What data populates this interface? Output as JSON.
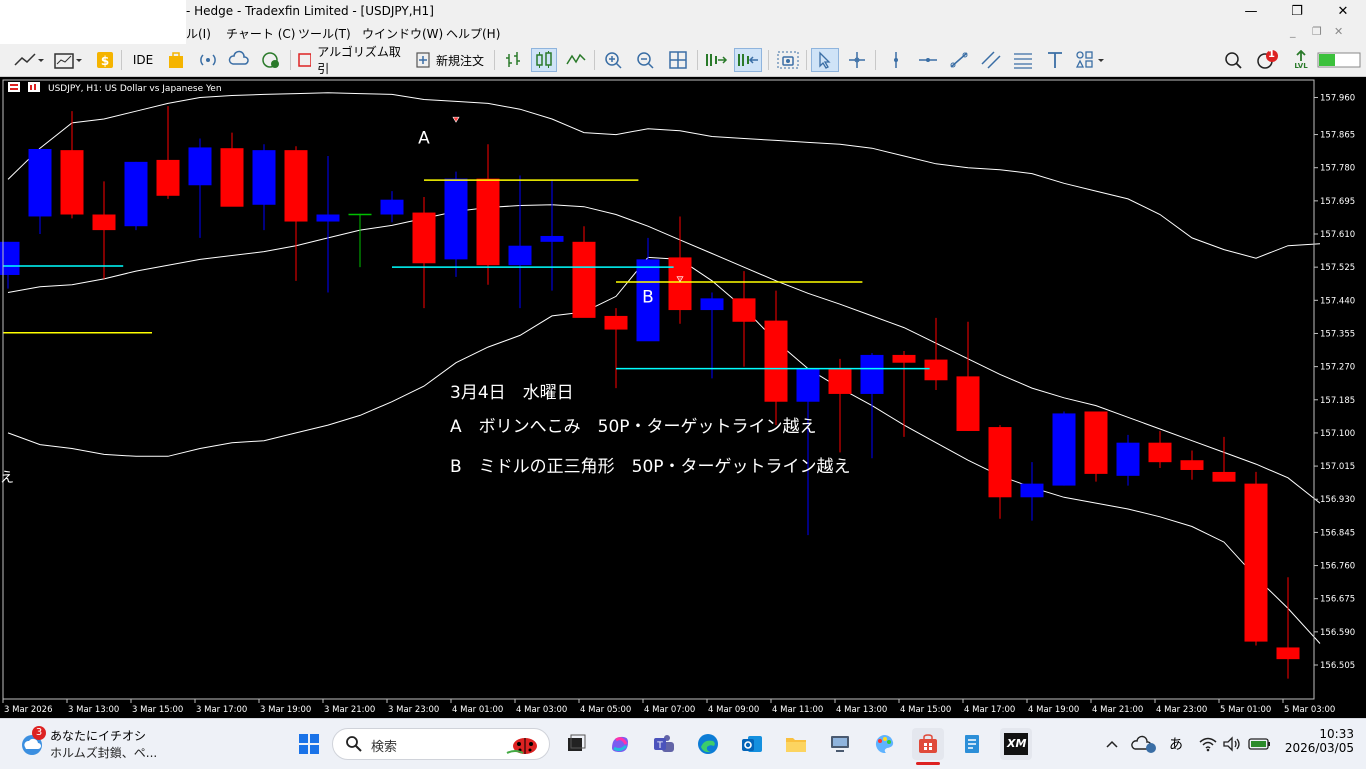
{
  "window": {
    "title": "- Hedge - Tradexfin Limited - [USDJPY,H1]",
    "controls": [
      "—",
      "❐",
      "✕"
    ],
    "mdi_controls": [
      "_",
      "❐",
      "✕"
    ]
  },
  "menu": {
    "items": [
      "ル(I)",
      "チャート (C)",
      "ツール(T)",
      "ウインドウ(W)",
      "ヘルプ(H)"
    ]
  },
  "toolbar": {
    "ide_label": "IDE",
    "algo_label": "アルゴリズム取引",
    "new_order_label": "新規注文",
    "notification_count": "1",
    "lvl_label": "LVL"
  },
  "chart": {
    "header": "USDJPY, H1:  US Dollar vs Japanese Yen",
    "annotations": {
      "label_a": "A",
      "label_b": "B",
      "date_line": "3月4日　水曜日",
      "line_a": "A　ボリンへこみ　50P・ターゲットライン越え",
      "line_b": "B　ミドルの正三角形　50P・ターゲットライン越え",
      "left_edge_char": "え"
    },
    "colors": {
      "background": "#000000",
      "bull": "#0000ff",
      "bear": "#ff0000",
      "bands": "#ffffff",
      "target_line": "#ffff00",
      "entry_line": "#00ffff"
    }
  },
  "chart_data": {
    "type": "candlestick",
    "symbol": "USDJPY",
    "timeframe": "H1",
    "y_ticks": [
      "157.960",
      "157.865",
      "157.780",
      "157.695",
      "157.610",
      "157.525",
      "157.440",
      "157.355",
      "157.270",
      "157.185",
      "157.100",
      "157.015",
      "156.930",
      "156.845",
      "156.760",
      "156.675",
      "156.590",
      "156.505"
    ],
    "x_labels": [
      "3 Mar 2026",
      "3 Mar 13:00",
      "3 Mar 15:00",
      "3 Mar 17:00",
      "3 Mar 19:00",
      "3 Mar 21:00",
      "3 Mar 23:00",
      "4 Mar 01:00",
      "4 Mar 03:00",
      "4 Mar 05:00",
      "4 Mar 07:00",
      "4 Mar 09:00",
      "4 Mar 11:00",
      "4 Mar 13:00",
      "4 Mar 15:00",
      "4 Mar 17:00",
      "4 Mar 19:00",
      "4 Mar 21:00",
      "4 Mar 23:00",
      "5 Mar 01:00",
      "5 Mar 03:00"
    ],
    "ylim": [
      156.46,
      157.99
    ],
    "candles": [
      {
        "o": 157.505,
        "h": 157.59,
        "l": 157.47,
        "c": 157.59
      },
      {
        "o": 157.655,
        "h": 157.828,
        "l": 157.61,
        "c": 157.828
      },
      {
        "o": 157.825,
        "h": 157.925,
        "l": 157.65,
        "c": 157.66
      },
      {
        "o": 157.66,
        "h": 157.745,
        "l": 157.495,
        "c": 157.62
      },
      {
        "o": 157.63,
        "h": 157.795,
        "l": 157.62,
        "c": 157.795
      },
      {
        "o": 157.8,
        "h": 157.938,
        "l": 157.7,
        "c": 157.708
      },
      {
        "o": 157.735,
        "h": 157.855,
        "l": 157.6,
        "c": 157.832
      },
      {
        "o": 157.83,
        "h": 157.87,
        "l": 157.7,
        "c": 157.68
      },
      {
        "o": 157.685,
        "h": 157.84,
        "l": 157.62,
        "c": 157.825
      },
      {
        "o": 157.825,
        "h": 157.835,
        "l": 157.49,
        "c": 157.642
      },
      {
        "o": 157.642,
        "h": 157.81,
        "l": 157.46,
        "c": 157.66
      },
      {
        "o": 157.66,
        "h": 157.662,
        "l": 157.525,
        "c": 157.66
      },
      {
        "o": 157.66,
        "h": 157.72,
        "l": 157.64,
        "c": 157.698
      },
      {
        "o": 157.665,
        "h": 157.705,
        "l": 157.42,
        "c": 157.535
      },
      {
        "o": 157.545,
        "h": 157.77,
        "l": 157.5,
        "c": 157.752
      },
      {
        "o": 157.752,
        "h": 157.84,
        "l": 157.48,
        "c": 157.53
      },
      {
        "o": 157.53,
        "h": 157.76,
        "l": 157.42,
        "c": 157.58
      },
      {
        "o": 157.59,
        "h": 157.75,
        "l": 157.465,
        "c": 157.605
      },
      {
        "o": 157.59,
        "h": 157.63,
        "l": 157.4,
        "c": 157.395
      },
      {
        "o": 157.4,
        "h": 157.42,
        "l": 157.215,
        "c": 157.365
      },
      {
        "o": 157.335,
        "h": 157.6,
        "l": 157.34,
        "c": 157.545
      },
      {
        "o": 157.55,
        "h": 157.655,
        "l": 157.38,
        "c": 157.415
      },
      {
        "o": 157.415,
        "h": 157.46,
        "l": 157.24,
        "c": 157.445
      },
      {
        "o": 157.445,
        "h": 157.515,
        "l": 157.27,
        "c": 157.385
      },
      {
        "o": 157.388,
        "h": 157.465,
        "l": 157.12,
        "c": 157.18
      },
      {
        "o": 157.18,
        "h": 157.245,
        "l": 156.838,
        "c": 157.265
      },
      {
        "o": 157.265,
        "h": 157.29,
        "l": 157.05,
        "c": 157.2
      },
      {
        "o": 157.2,
        "h": 157.305,
        "l": 157.035,
        "c": 157.3
      },
      {
        "o": 157.3,
        "h": 157.31,
        "l": 157.09,
        "c": 157.28
      },
      {
        "o": 157.288,
        "h": 157.395,
        "l": 157.21,
        "c": 157.235
      },
      {
        "o": 157.245,
        "h": 157.385,
        "l": 157.105,
        "c": 157.105
      },
      {
        "o": 157.115,
        "h": 157.12,
        "l": 156.88,
        "c": 156.935
      },
      {
        "o": 156.935,
        "h": 157.025,
        "l": 156.875,
        "c": 156.97
      },
      {
        "o": 156.965,
        "h": 157.155,
        "l": 156.965,
        "c": 157.15
      },
      {
        "o": 157.155,
        "h": 157.155,
        "l": 156.975,
        "c": 156.995
      },
      {
        "o": 156.99,
        "h": 157.095,
        "l": 156.965,
        "c": 157.075
      },
      {
        "o": 157.075,
        "h": 157.105,
        "l": 157.01,
        "c": 157.025
      },
      {
        "o": 157.03,
        "h": 157.055,
        "l": 156.98,
        "c": 157.005
      },
      {
        "o": 157.0,
        "h": 157.09,
        "l": 156.975,
        "c": 156.975
      },
      {
        "o": 156.97,
        "h": 157.0,
        "l": 156.555,
        "c": 156.565
      },
      {
        "o": 156.55,
        "h": 156.73,
        "l": 156.47,
        "c": 156.52
      }
    ],
    "bollinger": {
      "upper": [
        157.75,
        157.83,
        157.895,
        157.905,
        157.925,
        157.945,
        157.96,
        157.965,
        157.968,
        157.97,
        157.972,
        157.97,
        157.968,
        157.955,
        157.95,
        157.945,
        157.93,
        157.905,
        157.87,
        157.865,
        157.88,
        157.875,
        157.86,
        157.855,
        157.85,
        157.845,
        157.84,
        157.83,
        157.81,
        157.79,
        157.78,
        157.775,
        157.765,
        157.74,
        157.72,
        157.7,
        157.66,
        157.6,
        157.57,
        157.548,
        157.58,
        157.585
      ],
      "middle": [
        157.46,
        157.475,
        157.48,
        157.495,
        157.515,
        157.53,
        157.545,
        157.555,
        157.565,
        157.58,
        157.6,
        157.62,
        157.632,
        157.65,
        157.668,
        157.678,
        157.683,
        157.685,
        157.68,
        157.66,
        157.63,
        157.595,
        157.56,
        157.525,
        157.49,
        157.458,
        157.43,
        157.4,
        157.37,
        157.33,
        157.29,
        157.25,
        157.215,
        157.19,
        157.17,
        157.14,
        157.11,
        157.08,
        157.05,
        157.02,
        156.985,
        156.92
      ],
      "lower": [
        157.1,
        157.07,
        157.06,
        157.045,
        157.04,
        157.04,
        157.06,
        157.075,
        157.08,
        157.1,
        157.12,
        157.145,
        157.18,
        157.22,
        157.28,
        157.32,
        157.35,
        157.4,
        157.41,
        157.45,
        157.55,
        157.545,
        157.49,
        157.42,
        157.335,
        157.265,
        157.215,
        157.17,
        157.12,
        157.075,
        157.03,
        156.99,
        156.96,
        156.935,
        156.92,
        156.905,
        156.885,
        156.86,
        156.82,
        156.73,
        156.65,
        156.56
      ]
    },
    "horizontal_lines": [
      {
        "kind": "target",
        "y": 157.748,
        "from": 13,
        "to": 19.7
      },
      {
        "kind": "target",
        "y": 157.487,
        "from": 19,
        "to": 26.7
      },
      {
        "kind": "target",
        "y": 157.357,
        "from": -0.5,
        "to": 4.5
      },
      {
        "kind": "entry",
        "y": 157.528,
        "from": -0.5,
        "to": 3.6
      },
      {
        "kind": "entry",
        "y": 157.525,
        "from": 12,
        "to": 20.8
      },
      {
        "kind": "entry",
        "y": 157.265,
        "from": 19,
        "to": 28.8
      }
    ],
    "markers": [
      {
        "candle": 13,
        "price": 157.857,
        "text": "A"
      },
      {
        "candle": 20,
        "price": 157.45,
        "text": "B"
      }
    ]
  },
  "taskbar": {
    "weather_badge": "3",
    "news_line1": "あなたにイチオシ",
    "news_line2": "ホルムズ封鎖、ペ...",
    "search_placeholder": "検索",
    "ime_label": "あ",
    "time": "10:33",
    "date": "2026/03/05",
    "xm_label": "XM"
  }
}
